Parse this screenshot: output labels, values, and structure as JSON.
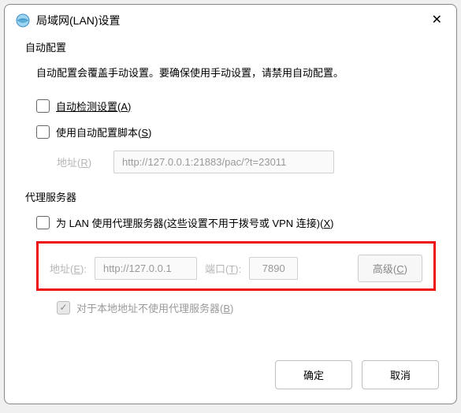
{
  "title": "局域网(LAN)设置",
  "autoConfig": {
    "legend": "自动配置",
    "desc": "自动配置会覆盖手动设置。要确保使用手动设置，请禁用自动配置。",
    "autoDetect": {
      "label_pre": "自动检测设置(",
      "key": "A",
      "label_post": ")",
      "checked": false
    },
    "useScript": {
      "label_pre": "使用自动配置脚本(",
      "key": "S",
      "label_post": ")",
      "checked": false
    },
    "address": {
      "label_pre": "地址(",
      "key": "R",
      "label_post": ")",
      "value": "http://127.0.0.1:21883/pac/?t=23011"
    }
  },
  "proxy": {
    "legend": "代理服务器",
    "useProxy": {
      "label_pre": "为 LAN 使用代理服务器(这些设置不用于拨号或 VPN 连接)(",
      "key": "X",
      "label_post": ")",
      "checked": false
    },
    "address": {
      "label_pre": "地址(",
      "key": "E",
      "label_post": "):",
      "value": "http://127.0.0.1"
    },
    "port": {
      "label_pre": "端口(",
      "key": "T",
      "label_post": "):",
      "value": "7890"
    },
    "advanced": {
      "label_pre": "高级(",
      "key": "C",
      "label_post": ")"
    },
    "bypassLocal": {
      "label_pre": "对于本地地址不使用代理服务器(",
      "key": "B",
      "label_post": ")",
      "checked": true
    }
  },
  "buttons": {
    "ok": "确定",
    "cancel": "取消"
  }
}
